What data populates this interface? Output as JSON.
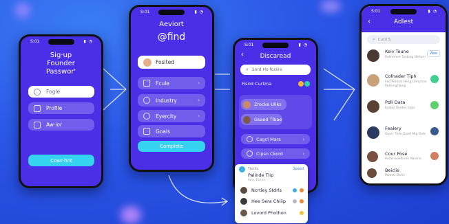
{
  "phone1": {
    "time": "S:01",
    "title_lines": [
      "Sig·up",
      "Founder",
      "Passwor'"
    ],
    "fields": [
      {
        "label": "Fogle",
        "style": "white"
      },
      {
        "label": "Profile",
        "style": "soft"
      },
      {
        "label": "Aw·ior",
        "style": "soft"
      }
    ],
    "cta": "Cowr·hnt"
  },
  "phone2": {
    "time": "S:01",
    "title_lines": [
      "Aeviort",
      "@find"
    ],
    "items": [
      {
        "label": "Fosited"
      },
      {
        "label": "Fcule"
      },
      {
        "label": "Industry"
      },
      {
        "label": "Eyercity"
      },
      {
        "label": "Goals"
      }
    ],
    "cta": "Complete"
  },
  "phone3": {
    "time": "S:01",
    "title": "Discaread",
    "search_placeholder": "Sord Ho fosiire",
    "section": "Fisrid Curtma",
    "profiles": [
      {
        "name": "Zrocke Uliks"
      },
      {
        "name": "Gsaed Tibae"
      }
    ],
    "options": [
      {
        "label": "Cagcl Mars"
      },
      {
        "label": "Cipsn Ckord"
      }
    ],
    "popup": {
      "subtitle": "Tierits",
      "action": "Spood",
      "heading": "Palinde Tlip",
      "meta": "Iarg. Etrhnl",
      "rows": [
        {
          "name": "Ncrtley Stdrls"
        },
        {
          "name": "Hee Sera Chiiip"
        },
        {
          "name": "Lovord Phothon"
        }
      ]
    }
  },
  "phone4": {
    "time": "S:01",
    "title": "Adlest",
    "search_placeholder": "Cucil S",
    "contacts": [
      {
        "name": "Keiv Toune",
        "sub": "Rallnerent Tesbing Dellprn",
        "action": "Wee"
      },
      {
        "name": "Cofnader Tiph",
        "sub": "Fed Pertnal Heng Gimptine Pashing/Tsing",
        "action": ""
      },
      {
        "name": "Pdli Data",
        "sub": "Kolbat Onetes Ilobs",
        "action": ""
      },
      {
        "name": "Fealery",
        "sub": "Gunlr Thile Goed Mig Fiats",
        "action": ""
      },
      {
        "name": "Cour Pose",
        "sub": "Pubw Goeflinne Aborrie",
        "action": ""
      },
      {
        "name": "Beiclis",
        "sub": "Polbeti Dorrs",
        "action": ""
      }
    ]
  },
  "colors": {
    "phone_bg": "#4a2ee8",
    "cyan": "#35d3ef",
    "bg": "#2a55e6"
  }
}
